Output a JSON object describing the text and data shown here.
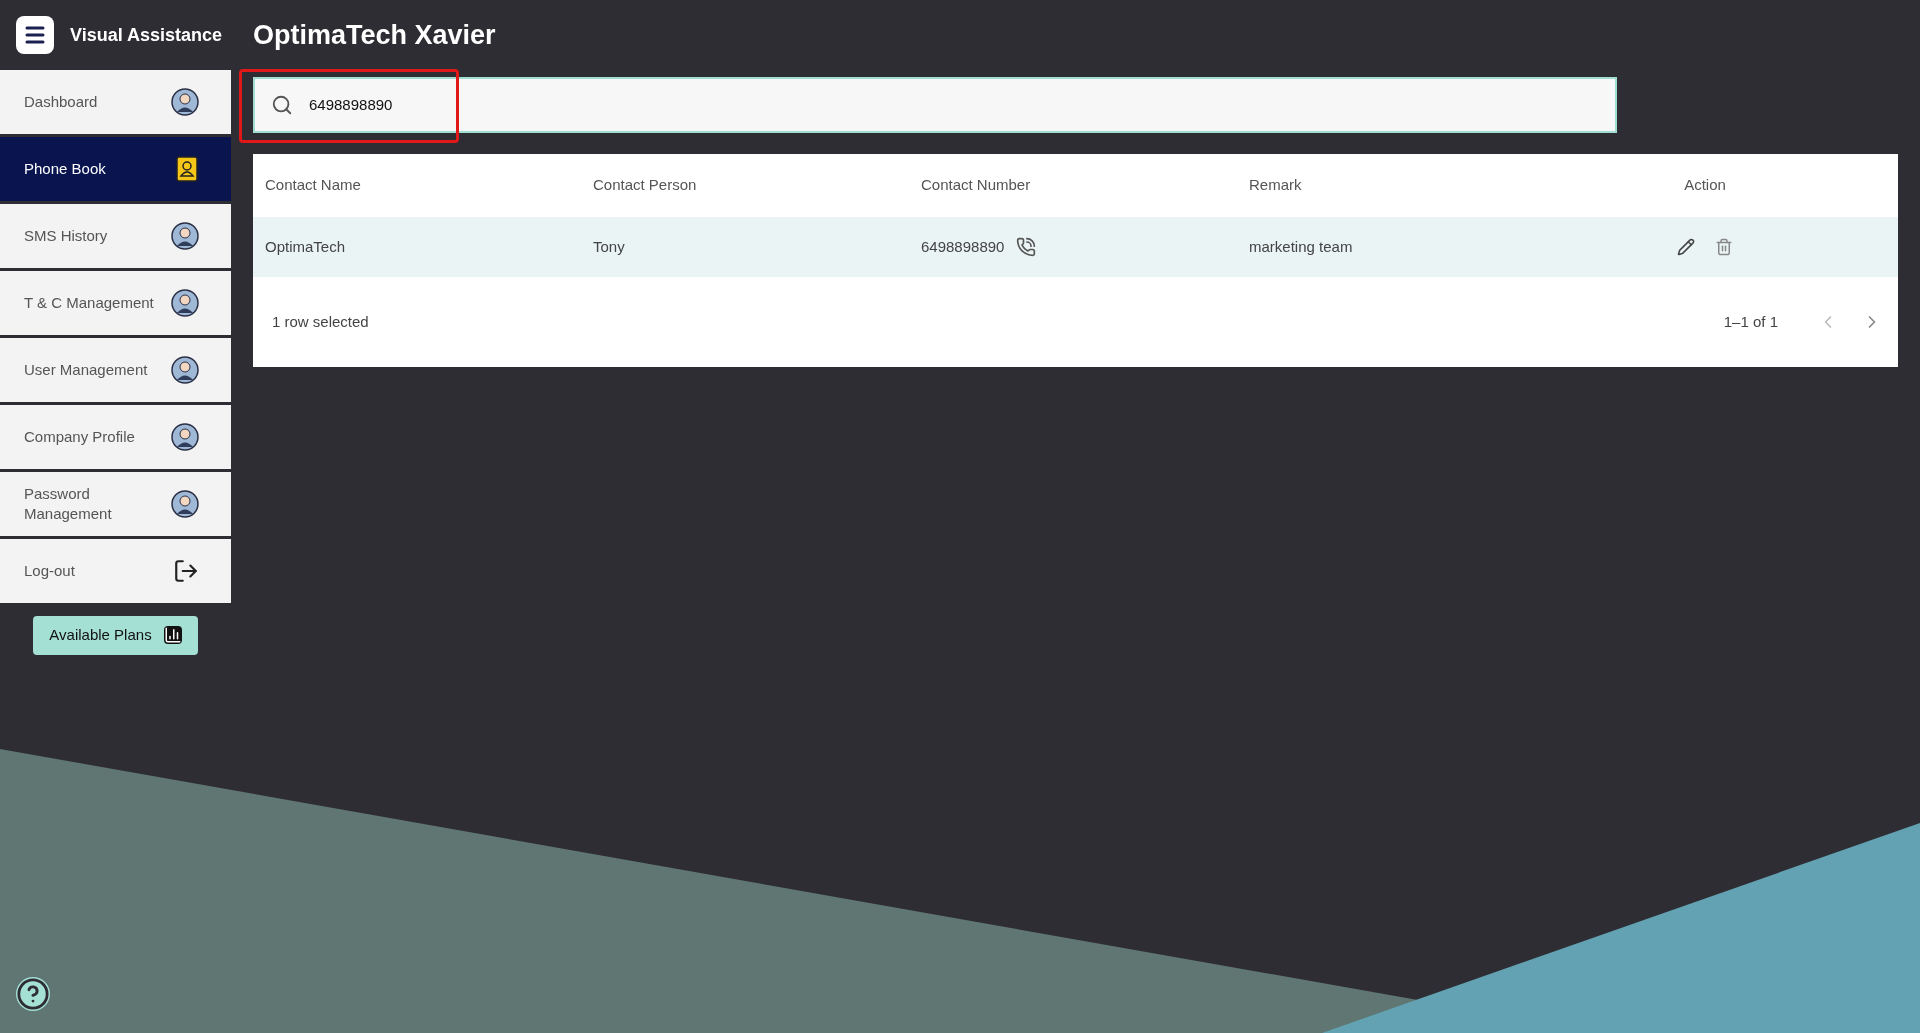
{
  "header": {
    "app_name": "Visual Assistance",
    "page_title": "OptimaTech Xavier"
  },
  "sidebar": {
    "items": [
      {
        "label": "Dashboard",
        "kind": "avatar",
        "selected": false
      },
      {
        "label": "Phone Book",
        "kind": "contacts",
        "selected": true
      },
      {
        "label": "SMS History",
        "kind": "avatar",
        "selected": false
      },
      {
        "label": "T & C Management",
        "kind": "avatar",
        "selected": false
      },
      {
        "label": "User Management",
        "kind": "avatar",
        "selected": false
      },
      {
        "label": "Company Profile",
        "kind": "avatar",
        "selected": false
      },
      {
        "label": "Password Management",
        "kind": "avatar",
        "selected": false
      },
      {
        "label": "Log-out",
        "kind": "logout",
        "selected": false
      }
    ],
    "plans_button": "Available Plans"
  },
  "search": {
    "value": "6498898890",
    "highlighted": true
  },
  "table": {
    "columns": [
      "Contact Name",
      "Contact Person",
      "Contact Number",
      "Remark",
      "Action"
    ],
    "rows": [
      {
        "cells": [
          "OptimaTech",
          "Tony",
          "6498898890",
          "marketing team"
        ],
        "selected": true
      }
    ],
    "footer": {
      "selection": "1 row selected",
      "range": "1–1 of 1"
    }
  }
}
